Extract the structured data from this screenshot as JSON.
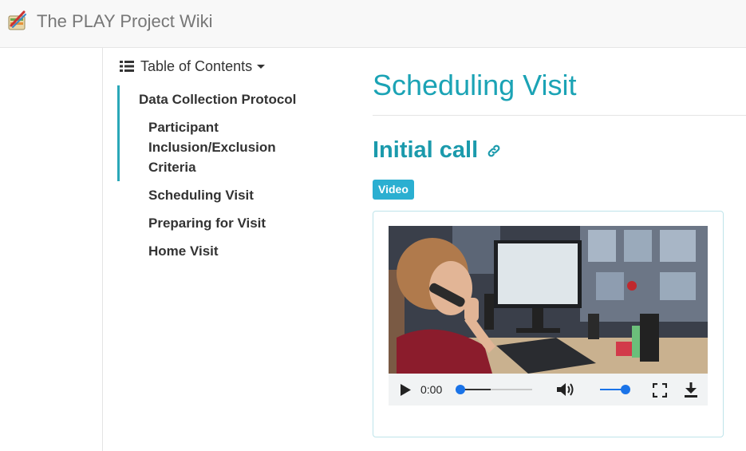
{
  "header": {
    "site_title": "The PLAY Project Wiki",
    "logo_icon": "play-project-logo-icon"
  },
  "toc": {
    "toggle_label": "Table of Contents",
    "items": [
      {
        "label": "Data Collection Protocol",
        "level": 1,
        "active": true
      },
      {
        "label": "Participant Inclusion/Exclusion Criteria",
        "level": 2,
        "active": true
      },
      {
        "label": "Scheduling Visit",
        "level": 2,
        "active": false
      },
      {
        "label": "Preparing for Visit",
        "level": 2,
        "active": false
      },
      {
        "label": "Home Visit",
        "level": 2,
        "active": false
      }
    ]
  },
  "main": {
    "page_title": "Scheduling Visit",
    "section_heading": "Initial call",
    "badge": "Video",
    "video": {
      "current_time": "0:00",
      "progress": 0,
      "volume": 1.0
    }
  },
  "colors": {
    "accent": "#1ba3b5",
    "badge": "#2bafd1",
    "control_blue": "#1a73e8"
  }
}
